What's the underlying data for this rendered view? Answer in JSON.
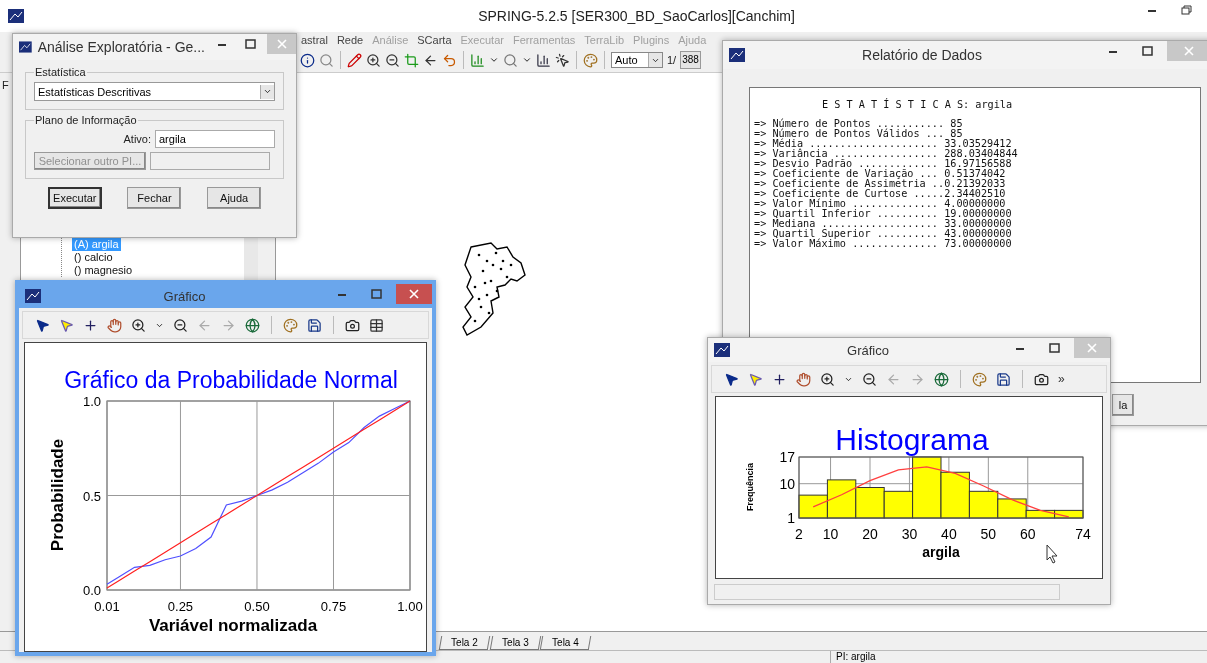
{
  "main_window": {
    "title": "SPRING-5.2.5 [SER300_BD_SaoCarlos][Canchim]",
    "menu": [
      {
        "label": "astral",
        "disabled": false
      },
      {
        "label": "Rede",
        "disabled": false
      },
      {
        "label": "Análise",
        "disabled": true
      },
      {
        "label": "SCarta",
        "disabled": false
      },
      {
        "label": "Executar",
        "disabled": true
      },
      {
        "label": "Ferramentas",
        "disabled": true
      },
      {
        "label": "TerraLib",
        "disabled": true
      },
      {
        "label": "Plugins",
        "disabled": true
      },
      {
        "label": "Ajuda",
        "disabled": true
      }
    ],
    "toolbar": {
      "scale_mode": "Auto",
      "page": "1/",
      "page_field": "388"
    },
    "side_tab": "F",
    "tree": [
      {
        "label": "(A) argila",
        "selected": true
      },
      {
        "label": "() calcio",
        "selected": false
      },
      {
        "label": "() magnesio",
        "selected": false
      }
    ],
    "tabs": [
      {
        "label": "Tela 2",
        "selected": false
      },
      {
        "label": "Tela 3",
        "selected": false
      },
      {
        "label": "Tela 4",
        "selected": false
      }
    ],
    "status_bar": "PI: argila"
  },
  "analysis_dialog": {
    "title": "Análise Exploratória - Ge...",
    "active": false,
    "statistic_group": "Estatística",
    "statistic": "Estatísticas Descritivas",
    "layer_group": "Plano de Informação",
    "active_label": "Ativo:",
    "active_value": "argila",
    "select_button": {
      "label": "Selecionar outro PI...",
      "disabled": true
    },
    "buttons": [
      "Executar",
      "Fechar",
      "Ajuda"
    ]
  },
  "report_window": {
    "title": "Relatório de Dados",
    "active": false,
    "heading": "E S T A T Í S T I C A S: argila",
    "lines": [
      "=> Número de Pontos ........... 85",
      "=> Número de Pontos Válidos ... 85",
      "=> Média ..................... 33.03529412",
      "=> Variância ................. 288.03404844",
      "=> Desvio Padrão ............. 16.97156588",
      "=> Coeficiente de Variação ... 0.51374042",
      "=> Coeficiente de Assimetria ..0.21392033",
      "=> Coeficiente de Curtose .....2.34402510",
      "=> Valor Mínimo .............. 4.00000000",
      "=> Quartil Inferior .......... 19.00000000",
      "=> Mediana ................... 33.00000000",
      "=> Quartil Superior .......... 43.00000000",
      "=> Valor Máximo .............. 73.00000000"
    ],
    "button": "la"
  },
  "probability_window": {
    "title": "Gráfico",
    "active": true,
    "chart_data": {
      "type": "line",
      "title": "Gráfico da Probabilidade Normal",
      "xlabel": "Variável normalizada",
      "ylabel": "Probabilidade",
      "x": [
        0.01,
        0.05,
        0.1,
        0.15,
        0.2,
        0.25,
        0.3,
        0.35,
        0.4,
        0.45,
        0.5,
        0.55,
        0.6,
        0.65,
        0.7,
        0.75,
        0.8,
        0.85,
        0.9,
        0.95,
        1.0
      ],
      "grid": true,
      "series": [
        {
          "type": "line",
          "color": "#5050ff",
          "values": [
            0.03,
            0.07,
            0.12,
            0.13,
            0.16,
            0.18,
            0.22,
            0.28,
            0.45,
            0.47,
            0.5,
            0.53,
            0.57,
            0.62,
            0.67,
            0.73,
            0.78,
            0.86,
            0.92,
            0.96,
            1.0
          ]
        },
        {
          "type": "line",
          "color": "#ff2020",
          "values": [
            0.01,
            0.05,
            0.1,
            0.15,
            0.2,
            0.25,
            0.3,
            0.35,
            0.4,
            0.45,
            0.5,
            0.55,
            0.6,
            0.65,
            0.7,
            0.75,
            0.8,
            0.85,
            0.9,
            0.95,
            1.0
          ]
        }
      ],
      "xlim": [
        0.01,
        1.0
      ],
      "ylim": [
        0,
        1
      ],
      "xticks": [
        {
          "value": 0.01,
          "label": "0.01"
        },
        {
          "value": 0.25,
          "label": "0.25"
        },
        {
          "value": 0.5,
          "label": "0.50"
        },
        {
          "value": 0.75,
          "label": "0.75"
        },
        {
          "value": 1.0,
          "label": "1.00"
        }
      ],
      "yticks": [
        {
          "value": 0,
          "label": "0.0"
        },
        {
          "value": 0.5,
          "label": "0.5"
        },
        {
          "value": 1,
          "label": "1.0"
        }
      ]
    }
  },
  "histogram_window": {
    "title": "Gráfico",
    "active": false,
    "toolbar_more": "»",
    "chart_data": {
      "type": "bar",
      "title": "Histograma",
      "xlabel": "argila",
      "ylabel": "Frequência",
      "x": [
        5.6,
        12.8,
        20,
        27.2,
        34.4,
        41.6,
        48.8,
        56,
        63.2,
        70.4
      ],
      "grid": true,
      "series": [
        {
          "type": "bar",
          "color": "#ffff00",
          "values": [
            7,
            11,
            9,
            8,
            17,
            13,
            8,
            6,
            3,
            3
          ]
        },
        {
          "type": "line",
          "color": "#ff4040",
          "values": [
            3.9,
            7.1,
            10.8,
            13.6,
            14.4,
            12.7,
            9.4,
            5.8,
            3.0,
            1.3
          ]
        }
      ],
      "xlim": [
        2,
        74
      ],
      "ylim": [
        1,
        17
      ],
      "xticks": [
        2,
        10,
        20,
        30,
        40,
        50,
        60,
        74
      ],
      "yticks": [
        1,
        10,
        17
      ]
    }
  }
}
